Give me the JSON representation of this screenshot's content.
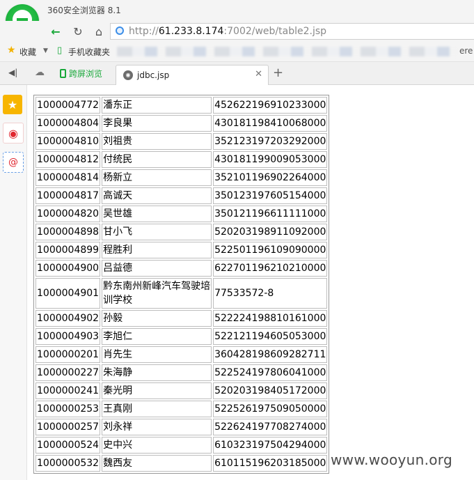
{
  "browser": {
    "title": "360安全浏览器 8.1",
    "url_scheme": "http://",
    "url_host": "61.233.8.174",
    "url_rest": ":7002/web/table2.jsp",
    "bookmarks": {
      "favorites_label": "收藏",
      "mobile_label": "手机收藏夹",
      "tail_text": "ere"
    },
    "tabs": {
      "cross_screen_label": "跨屏浏览",
      "active_tab_label": "jdbc.jsp"
    },
    "colors": {
      "accent_green": "#19a83a",
      "favorites_yellow": "#f7b500",
      "weibo_red": "#e0262f"
    }
  },
  "table": {
    "rows": [
      {
        "id": "1000004772",
        "name": "潘东正",
        "number": "452622196910233000"
      },
      {
        "id": "1000004804",
        "name": "李良果",
        "number": "430181198410068000"
      },
      {
        "id": "1000004810",
        "name": "刘祖贵",
        "number": "352123197203292000"
      },
      {
        "id": "1000004812",
        "name": "付统民",
        "number": "430181199009053000"
      },
      {
        "id": "1000004814",
        "name": "杨新立",
        "number": "352101196902264000"
      },
      {
        "id": "1000004817",
        "name": "高诚天",
        "number": "350123197605154000"
      },
      {
        "id": "1000004820",
        "name": "吴世雄",
        "number": "350121196611111000"
      },
      {
        "id": "1000004898",
        "name": "甘小飞",
        "number": "520203198911092000"
      },
      {
        "id": "1000004899",
        "name": "程胜利",
        "number": "522501196109090000"
      },
      {
        "id": "1000004900",
        "name": "吕益德",
        "number": "622701196210210000"
      },
      {
        "id": "1000004901",
        "name": "黔东南州新峰汽车驾驶培训学校",
        "number": "77533572-8"
      },
      {
        "id": "1000004902",
        "name": "孙毅",
        "number": "522224198810161000"
      },
      {
        "id": "1000004903",
        "name": "李旭仁",
        "number": "522121194605053000"
      },
      {
        "id": "1000000201",
        "name": "肖先生",
        "number": "360428198609282711"
      },
      {
        "id": "1000000227",
        "name": "朱海静",
        "number": "522524197806041000"
      },
      {
        "id": "1000000241",
        "name": "秦光明",
        "number": "520203198405172000"
      },
      {
        "id": "1000000253",
        "name": "王真刚",
        "number": "522526197509050000"
      },
      {
        "id": "1000000257",
        "name": "刘永祥",
        "number": "522624197708274000"
      },
      {
        "id": "1000000524",
        "name": "史中兴",
        "number": "610323197504294000"
      },
      {
        "id": "1000000532",
        "name": "魏西友",
        "number": "610115196203185000"
      }
    ]
  },
  "watermark": "www.wooyun.org"
}
